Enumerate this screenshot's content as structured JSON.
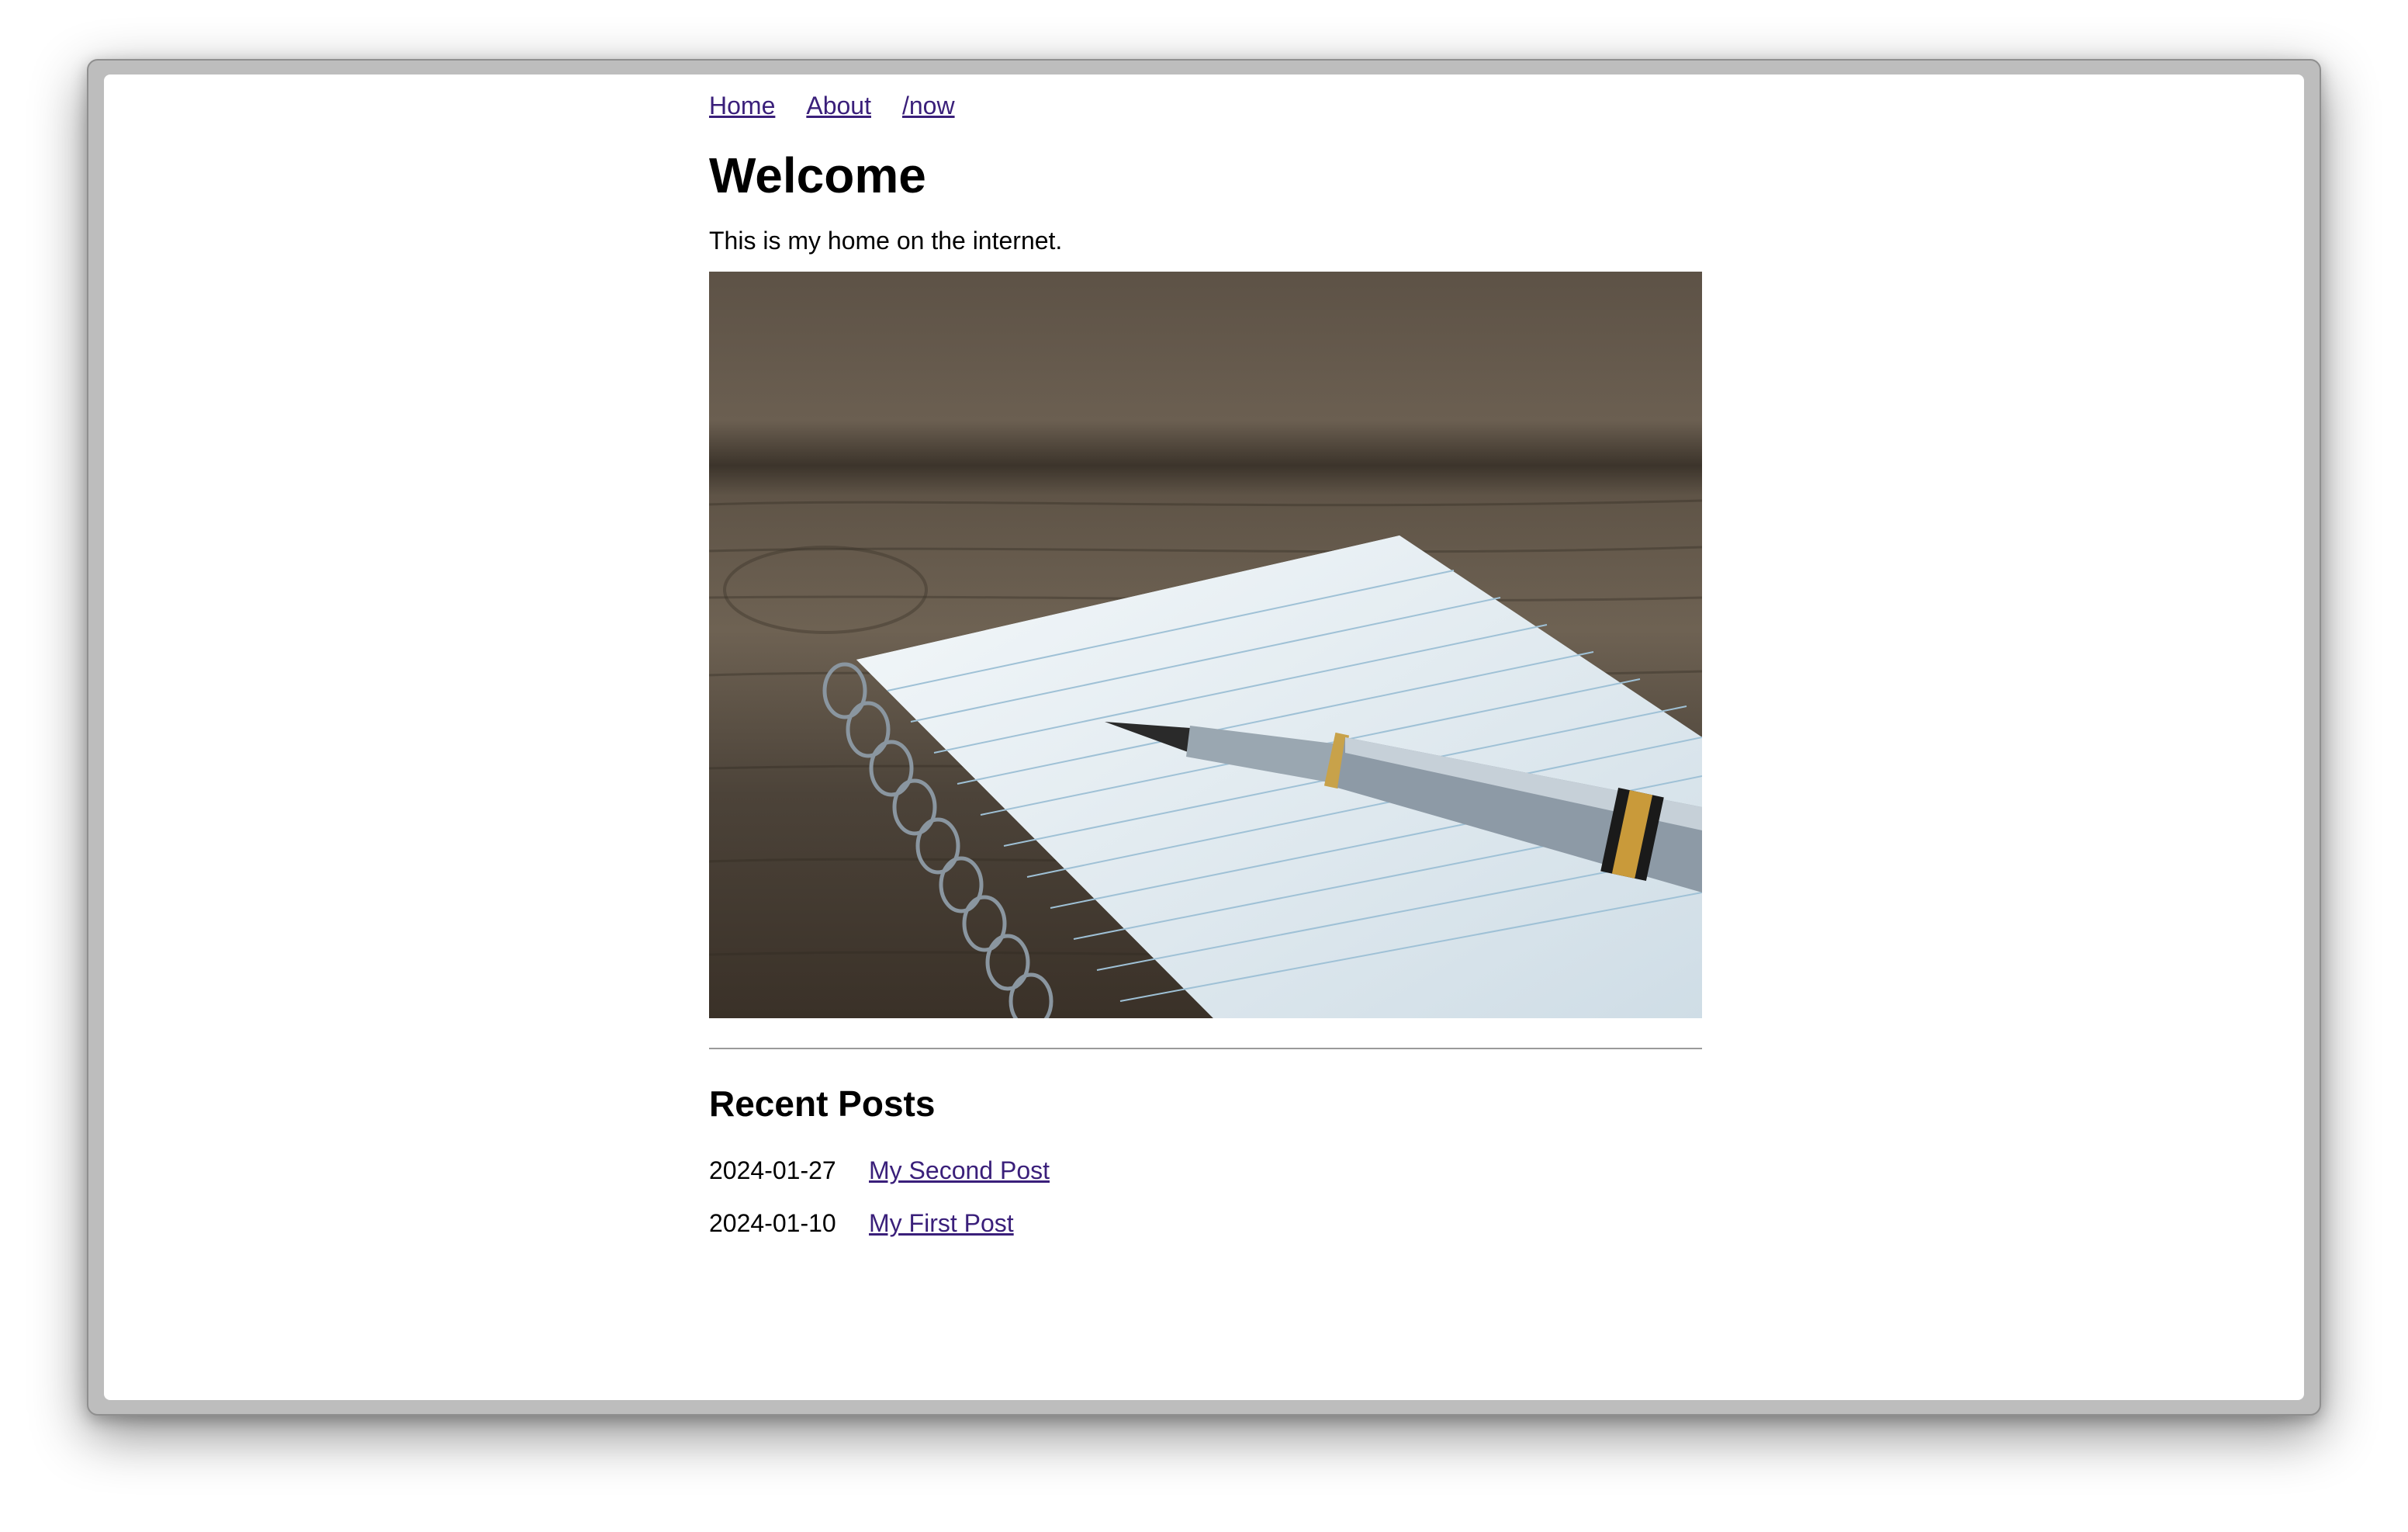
{
  "nav": {
    "items": [
      {
        "label": "Home"
      },
      {
        "label": "About"
      },
      {
        "label": "/now"
      }
    ]
  },
  "main": {
    "title": "Welcome",
    "intro": "This is my home on the internet.",
    "hero_image": {
      "icon": "notebook-pen-photo"
    }
  },
  "recent_posts": {
    "title": "Recent Posts",
    "posts": [
      {
        "date": "2024-01-27",
        "title": "My Second Post"
      },
      {
        "date": "2024-01-10",
        "title": "My First Post"
      }
    ]
  },
  "colors": {
    "link": "#3a1f7a",
    "text": "#000000",
    "background": "#ffffff"
  }
}
